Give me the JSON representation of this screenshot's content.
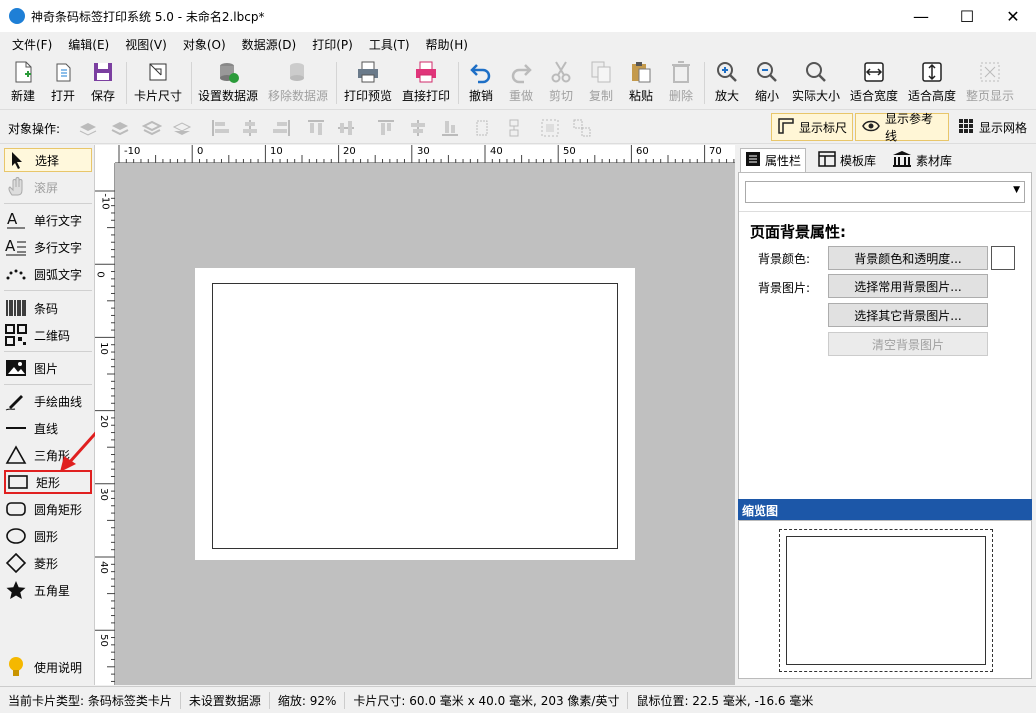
{
  "window": {
    "title": "神奇条码标签打印系统 5.0 - 未命名2.lbcp*",
    "minimize": "—",
    "maximize": "☐",
    "close": "✕"
  },
  "menu": [
    "文件(F)",
    "编辑(E)",
    "视图(V)",
    "对象(O)",
    "数据源(D)",
    "打印(P)",
    "工具(T)",
    "帮助(H)"
  ],
  "toolbar": {
    "new": "新建",
    "open": "打开",
    "save": "保存",
    "card_size": "卡片尺寸",
    "set_datasource": "设置数据源",
    "remove_datasource": "移除数据源",
    "print_preview": "打印预览",
    "direct_print": "直接打印",
    "undo": "撤销",
    "redo": "重做",
    "cut": "剪切",
    "copy": "复制",
    "paste": "粘贴",
    "delete": "删除",
    "zoom_in": "放大",
    "zoom_out": "缩小",
    "actual_size": "实际大小",
    "fit_width": "适合宽度",
    "fit_height": "适合高度",
    "fit_page": "整页显示"
  },
  "objbar": {
    "label": "对象操作:",
    "show_ruler": "显示标尺",
    "show_guides": "显示参考线",
    "show_grid": "显示网格"
  },
  "tools": {
    "select": "选择",
    "scroll": "滚屏",
    "single_text": "单行文字",
    "multi_text": "多行文字",
    "arc_text": "圆弧文字",
    "barcode": "条码",
    "qrcode": "二维码",
    "image": "图片",
    "freehand": "手绘曲线",
    "line": "直线",
    "triangle": "三角形",
    "rectangle": "矩形",
    "round_rect": "圆角矩形",
    "ellipse": "圆形",
    "diamond": "菱形",
    "star": "五角星",
    "help": "使用说明"
  },
  "ruler": {
    "h_labels": [
      "-10",
      "0",
      "10",
      "20",
      "30",
      "40",
      "50",
      "60",
      "70"
    ],
    "v_labels": [
      "-10",
      "0",
      "10",
      "20",
      "30",
      "40",
      "50"
    ]
  },
  "panel": {
    "tabs": [
      "属性栏",
      "模板库",
      "素材库"
    ],
    "dropdown_value": "",
    "heading": "页面背景属性:",
    "bg_color_label": "背景颜色:",
    "bg_color_btn": "背景颜色和透明度...",
    "bg_image_label": "背景图片:",
    "pick_common_btn": "选择常用背景图片...",
    "pick_other_btn": "选择其它背景图片...",
    "clear_btn": "清空背景图片",
    "thumbnail_title": "缩览图"
  },
  "status": {
    "card_type": "当前卡片类型: 条码标签类卡片",
    "datasource": "未设置数据源",
    "zoom": "缩放: 92%",
    "card_size": "卡片尺寸: 60.0 毫米 x 40.0 毫米, 203 像素/英寸",
    "mouse": "鼠标位置: 22.5 毫米, -16.6 毫米"
  },
  "colors": {
    "accent": "#1e7fd6",
    "highlight": "#e02020",
    "panel_header": "#1c57a8"
  }
}
